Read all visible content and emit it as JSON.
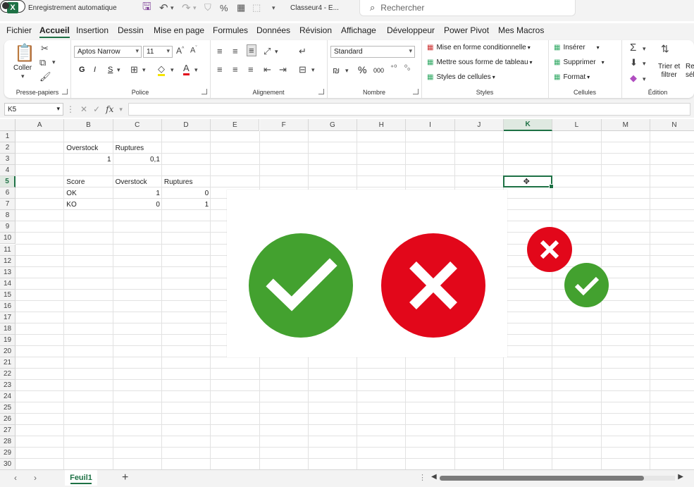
{
  "title_bar": {
    "autosave_label": "Enregistrement automatique",
    "doc_title": "Classeur4 - E...",
    "search_placeholder": "Rechercher"
  },
  "menu": {
    "tabs": [
      "Fichier",
      "Accueil",
      "Insertion",
      "Dessin",
      "Mise en page",
      "Formules",
      "Données",
      "Révision",
      "Affichage",
      "Développeur",
      "Power Pivot",
      "Mes Macros"
    ],
    "active": "Accueil"
  },
  "ribbon": {
    "clipboard": {
      "label": "Presse-papiers",
      "paste": "Coller"
    },
    "font": {
      "label": "Police",
      "name": "Aptos Narrow",
      "size": "11",
      "bold": "G",
      "italic": "I",
      "underline": "S"
    },
    "alignment": {
      "label": "Alignement"
    },
    "number": {
      "label": "Nombre",
      "format": "Standard",
      "percent": "%",
      "thousands": "000"
    },
    "styles": {
      "label": "Styles",
      "conditional": "Mise en forme conditionnelle",
      "table": "Mettre sous forme de tableau",
      "cell_styles": "Styles de cellules"
    },
    "cells": {
      "label": "Cellules",
      "insert": "Insérer",
      "delete": "Supprimer",
      "format": "Format"
    },
    "editing": {
      "label": "Édition",
      "sort": "Trier et filtrer",
      "sort_line1": "Trier et",
      "sort_line2": "filtrer",
      "cut_off_line1": "Re",
      "cut_off_line2": "sél"
    }
  },
  "formula_bar": {
    "name_box": "K5",
    "fx": "fx",
    "formula": ""
  },
  "columns": [
    "A",
    "B",
    "C",
    "D",
    "E",
    "F",
    "G",
    "H",
    "I",
    "J",
    "K",
    "L",
    "M",
    "N"
  ],
  "rows": [
    "1",
    "2",
    "3",
    "4",
    "5",
    "6",
    "7",
    "8",
    "9",
    "10",
    "11",
    "12",
    "13",
    "14",
    "15",
    "16",
    "17",
    "18",
    "19",
    "20",
    "21",
    "22",
    "23",
    "24",
    "25",
    "26",
    "27",
    "28",
    "29",
    "30"
  ],
  "selected_cell": "K5",
  "cells": {
    "B2": "Overstock",
    "C2": "Ruptures",
    "B3": "1",
    "C3": "0,1",
    "B5": "Score",
    "C5": "Overstock",
    "D5": "Ruptures",
    "B6": "OK",
    "C6": "1",
    "D6": "0",
    "B7": "KO",
    "C7": "0",
    "D7": "1"
  },
  "icons": {
    "green": "#43a12f",
    "red": "#e2071a"
  },
  "sheet": {
    "tab": "Feuil1",
    "add": "+"
  }
}
